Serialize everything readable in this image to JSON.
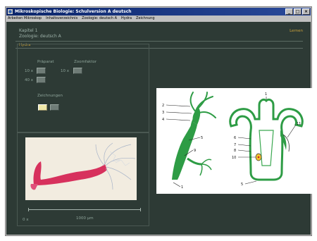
{
  "window": {
    "title": "Mikroskopische Biologie: Schulversion A deutsch",
    "controls": [
      "_",
      "□",
      "×"
    ]
  },
  "menu": {
    "items": [
      "Arbeiten Mikroskop",
      "Inhaltsverzeichnis",
      "Zoologie: deutsch A",
      "Hydra",
      "Zeichnung"
    ]
  },
  "header": {
    "chapter": "Kapitel 1",
    "subject": "Zoologie: deutsch A",
    "right_link": "Lernen"
  },
  "section": {
    "label": "Hydra"
  },
  "controls": {
    "praparat_label": "Präparat",
    "zoom_label": "Zoomfaktor",
    "mag_10x": "10 x",
    "mag_40x": "40 x",
    "zoom_10x": "10 x",
    "drawings_label": "Zeichnungen"
  },
  "photo": {
    "scale_left": "0 x",
    "scale_text": "1000 µm"
  },
  "diagram": {
    "labels": [
      "1",
      "2",
      "3",
      "4",
      "5",
      "6",
      "7",
      "8",
      "9",
      "10",
      "11",
      "12"
    ]
  },
  "colors": {
    "window_bg": "#c0c0c0",
    "client_bg": "#2d3a35",
    "accent": "#c9a03a",
    "specimen": "#d41d4f",
    "hydra_green": "#2e9c45",
    "tissue_yellow": "#f2c230"
  }
}
